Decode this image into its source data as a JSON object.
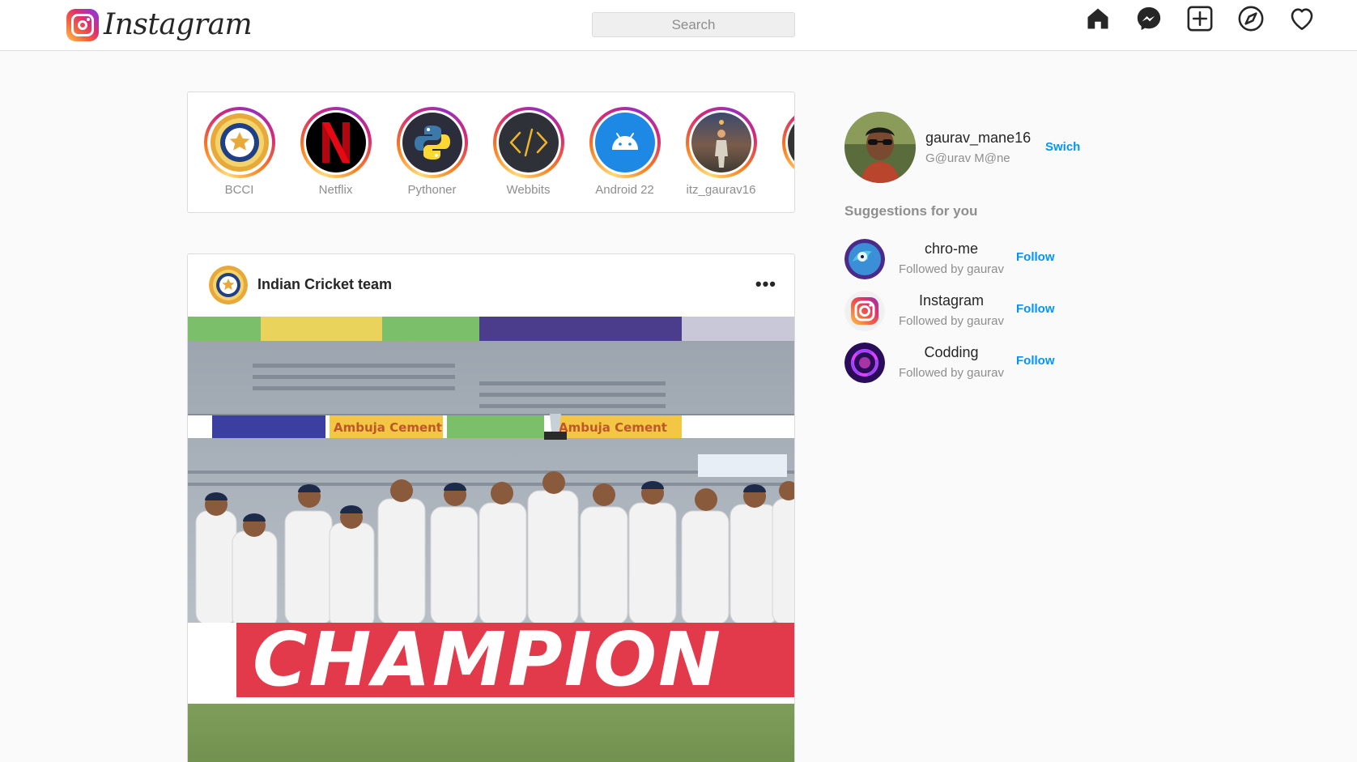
{
  "brand": {
    "name": "Instagram"
  },
  "search": {
    "placeholder": "Search"
  },
  "nav": {
    "icons": [
      "home-icon",
      "messenger-icon",
      "new-post-icon",
      "explore-icon",
      "activity-heart-icon"
    ]
  },
  "stories": [
    {
      "label": "BCCI",
      "avatar": "bcci-logo"
    },
    {
      "label": "Netflix",
      "avatar": "netflix-logo"
    },
    {
      "label": "Pythoner",
      "avatar": "python-logo"
    },
    {
      "label": "Webbits",
      "avatar": "code-icon"
    },
    {
      "label": "Android 22",
      "avatar": "android-logo"
    },
    {
      "label": "itz_gaurav16",
      "avatar": "person-photo"
    }
  ],
  "post": {
    "username": "Indian Cricket team",
    "more": "•••",
    "image": {
      "banner_text": "CHAMPION",
      "ad_text": "Ambuja Cement"
    }
  },
  "profile": {
    "username": "gaurav_mane16",
    "fullname": "G@urav M@ne",
    "switch_label": "Swich"
  },
  "suggestions": {
    "title": "Suggestions for you",
    "items": [
      {
        "name": "chro-me",
        "sub": "Followed by gaurav",
        "action": "Follow"
      },
      {
        "name": "Instagram",
        "sub": "Followed by gaurav",
        "action": "Follow"
      },
      {
        "name": "Codding",
        "sub": "Followed by gaurav",
        "action": "Follow"
      }
    ]
  },
  "colors": {
    "accent": "#0095f6",
    "border": "#dbdbdb",
    "muted": "#8e8e8e",
    "background": "#fafafa"
  }
}
